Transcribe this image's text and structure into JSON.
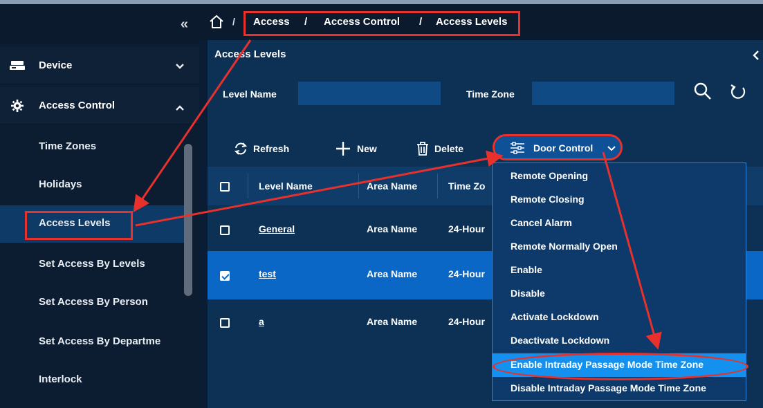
{
  "sidebar": {
    "collapse_icon": "double-chevron-left",
    "groups": [
      {
        "label": "Device",
        "icon": "device-icon",
        "expanded": false
      },
      {
        "label": "Access Control",
        "icon": "gear-icon",
        "expanded": true
      }
    ],
    "items": [
      {
        "label": "Time Zones"
      },
      {
        "label": "Holidays"
      },
      {
        "label": "Access Levels",
        "active": true
      },
      {
        "label": "Set Access By Levels"
      },
      {
        "label": "Set Access By Person"
      },
      {
        "label": "Set Access By Departme"
      },
      {
        "label": "Interlock"
      }
    ]
  },
  "breadcrumb": {
    "home_icon": "home-icon",
    "separator": "/",
    "items": [
      "Access",
      "Access Control",
      "Access Levels"
    ]
  },
  "panel": {
    "title": "Access Levels",
    "collapse_icon": "chevron-left",
    "filters": {
      "level_name_label": "Level Name",
      "level_name_value": "",
      "time_zone_label": "Time Zone",
      "time_zone_value": "",
      "search_icon": "search-icon",
      "reset_icon": "reset-icon"
    },
    "toolbar": {
      "refresh": "Refresh",
      "new": "New",
      "delete": "Delete",
      "door_control": "Door Control"
    },
    "table": {
      "headers": [
        "Level Name",
        "Area Name",
        "Time Zo"
      ],
      "rows": [
        {
          "level": "General",
          "area": "Area Name",
          "tz": "24-Hour",
          "checked": false
        },
        {
          "level": "test",
          "area": "Area Name",
          "tz": "24-Hour",
          "checked": true
        },
        {
          "level": "a",
          "area": "Area Name",
          "tz": "24-Hour",
          "checked": false
        }
      ]
    }
  },
  "door_control_menu": [
    "Remote Opening",
    "Remote Closing",
    "Cancel Alarm",
    "Remote Normally Open",
    "Enable",
    "Disable",
    "Activate Lockdown",
    "Deactivate Lockdown",
    "Enable Intraday Passage Mode Time Zone",
    "Disable Intraday Passage Mode Time Zone"
  ],
  "highlighted_menu_item": "Enable Intraday Passage Mode Time Zone",
  "colors": {
    "sidebar_bg": "#0c1d31",
    "panel_bg": "#0d3154",
    "selected_row": "#0a67c6",
    "menu_highlight": "#1491ee",
    "annotation": "#e8312c"
  }
}
